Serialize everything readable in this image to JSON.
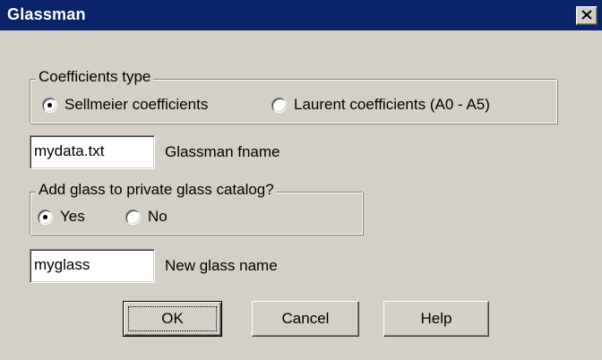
{
  "window": {
    "title": "Glassman",
    "close_icon": "close-icon"
  },
  "coefficients_group": {
    "legend": "Coefficients type",
    "options": [
      {
        "label": "Sellmeier coefficients",
        "selected": true
      },
      {
        "label": "Laurent coefficients (A0 - A5)",
        "selected": false
      }
    ]
  },
  "fname": {
    "value": "mydata.txt",
    "label": "Glassman fname"
  },
  "catalog_group": {
    "legend": "Add glass to private glass catalog?",
    "options": [
      {
        "label": "Yes",
        "selected": true
      },
      {
        "label": "No",
        "selected": false
      }
    ]
  },
  "glass_name": {
    "value": "myglass",
    "label": "New glass name"
  },
  "buttons": {
    "ok": "OK",
    "cancel": "Cancel",
    "help": "Help"
  },
  "colors": {
    "titlebar": "#0a246a",
    "face": "#d4d0c8"
  }
}
